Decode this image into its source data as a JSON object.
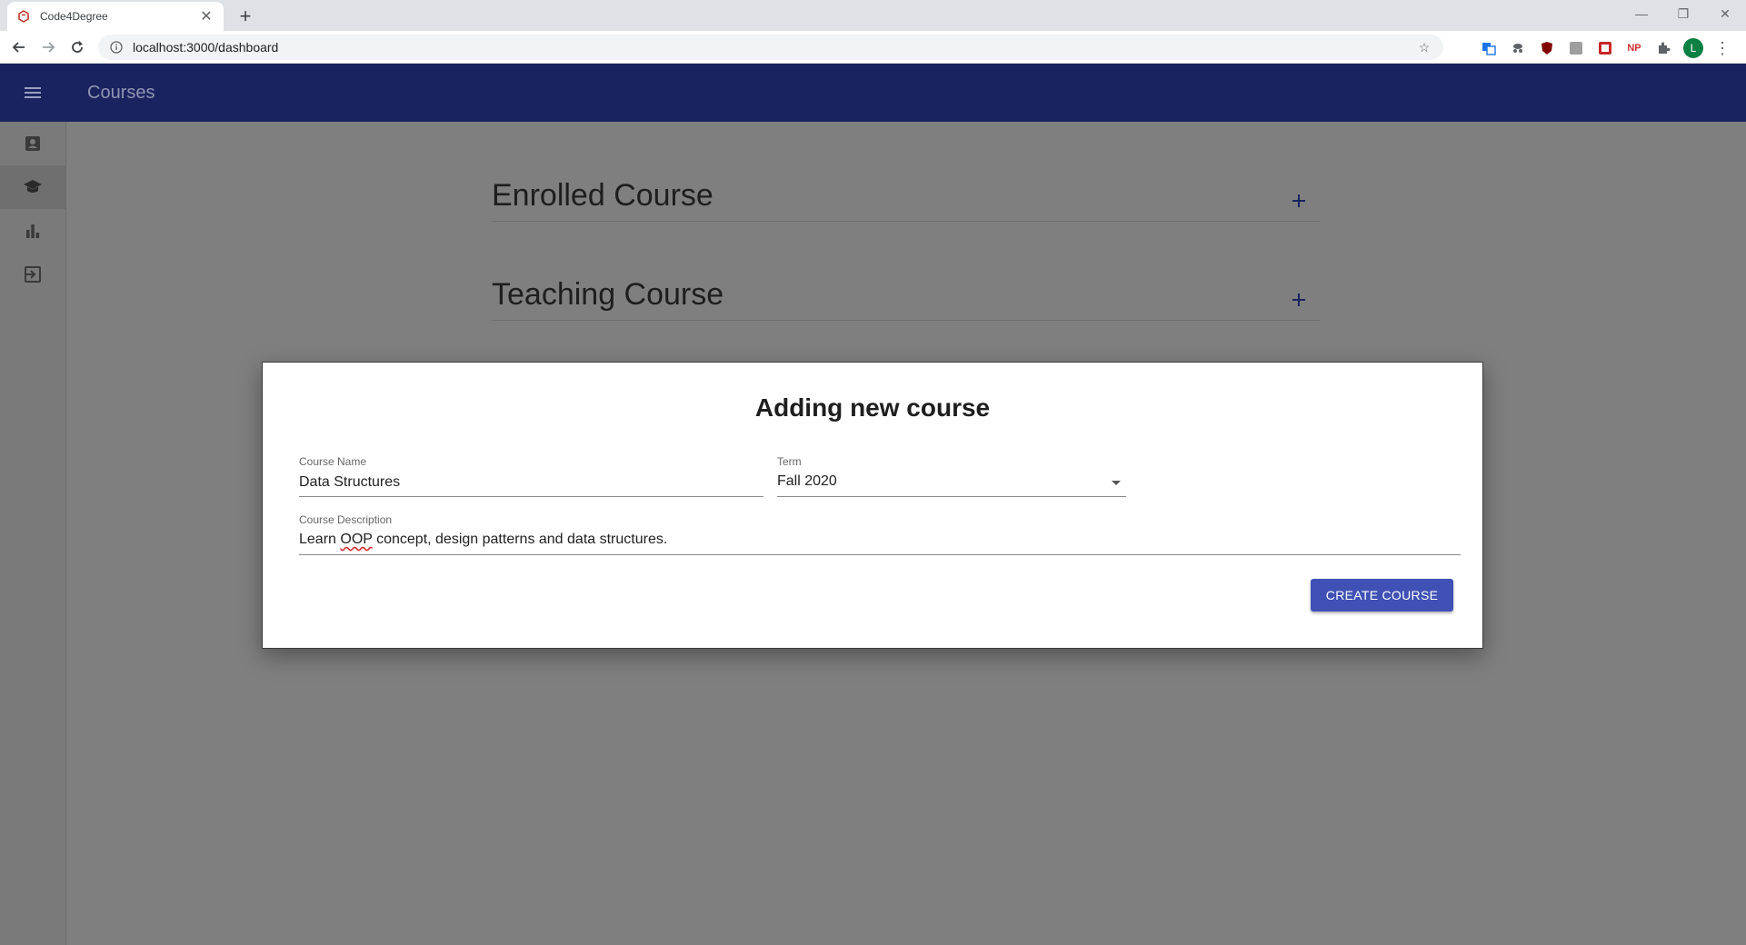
{
  "browser": {
    "tab_title": "Code4Degree",
    "url": "localhost:3000/dashboard",
    "profile_initial": "L",
    "np_extension_label": "NP"
  },
  "app": {
    "appbar_title": "Courses",
    "sections": [
      {
        "title": "Enrolled Course"
      },
      {
        "title": "Teaching Course"
      }
    ],
    "drawer_items": [
      "profile-icon",
      "school-icon",
      "bar-chart-icon",
      "exit-icon"
    ]
  },
  "dialog": {
    "title": "Adding new course",
    "course_name_label": "Course Name",
    "course_name_value": "Data Structures",
    "term_label": "Term",
    "term_value": "Fall 2020",
    "description_label": "Course Description",
    "description_parts": [
      "Learn ",
      "OOP",
      " concept, design patterns and data structures."
    ],
    "create_button": "CREATE COURSE"
  },
  "colors": {
    "appbar": "#1a2360",
    "accent": "#3f51b5",
    "overlay": "#808080"
  }
}
